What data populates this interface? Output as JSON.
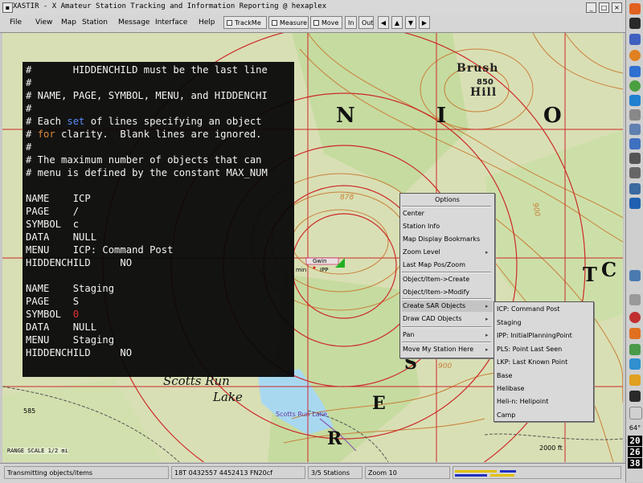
{
  "window": {
    "title": "XASTIR - X Amateur Station Tracking and Information Reporting @ hexaplex"
  },
  "menubar": {
    "items": [
      "File",
      "View",
      "Map",
      "Station",
      "Message",
      "Interface",
      "Help"
    ],
    "toggles": [
      "TrackMe",
      "Measure",
      "Move"
    ],
    "zoom_in": "In",
    "zoom_out": "Out"
  },
  "terminal": {
    "lines": [
      "#       HIDDENCHILD must be the last line",
      "#",
      "# NAME, PAGE, SYMBOL, MENU, and HIDDENCHI",
      "#",
      "# Each set of lines specifying an object",
      "# for clarity.  Blank lines are ignored.",
      "#",
      "# The maximum number of objects that can",
      "# menu is defined by the constant MAX_NUM",
      "",
      "NAME    ICP",
      "PAGE    /",
      "SYMBOL  c",
      "DATA    NULL",
      "MENU    ICP: Command Post",
      "HIDDENCHILD     NO",
      "",
      "NAME    Staging",
      "PAGE    S",
      "SYMBOL  0",
      "DATA    NULL",
      "MENU    Staging",
      "HIDDENCHILD     NO"
    ],
    "highlights": {
      "set": "set",
      "for": "for",
      "symbol_zero": "0"
    }
  },
  "map_labels": {
    "brush_hill_1": "Brush",
    "brush_hill_2": "Hill",
    "elev_850": "850",
    "elev_878": "878",
    "elev_900": "900",
    "elev_900b": "900",
    "letter_n": "N",
    "letter_i": "I",
    "letter_o": "O",
    "letter_c": "C",
    "letter_t": "T",
    "letter_s": "S",
    "letter_e": "E",
    "letter_r": "R",
    "scotts_run_1": "Scotts Run",
    "scotts_run_2": "Lake",
    "scotts_run_lake": "Scotts Run Lake",
    "station_a": "Gwin",
    "station_b": "IPP",
    "station_c": "min",
    "elev_585": "585",
    "scale": "RANGE SCALE 1/2 mi",
    "ft_2000": "2000 ft"
  },
  "options_menu": {
    "title": "Options",
    "items": [
      {
        "label": "Center",
        "submenu": false
      },
      {
        "label": "Station Info",
        "submenu": false
      },
      {
        "label": "Map Display Bookmarks",
        "submenu": false
      },
      {
        "label": "Zoom Level",
        "submenu": true
      },
      {
        "label": "Last Map Pos/Zoom",
        "submenu": false
      },
      {
        "label": "Object/Item->Create",
        "submenu": false
      },
      {
        "label": "Object/Item->Modify",
        "submenu": false
      },
      {
        "label": "Create SAR Objects",
        "submenu": true
      },
      {
        "label": "Draw CAD Objects",
        "submenu": true
      },
      {
        "label": "Pan",
        "submenu": true
      },
      {
        "label": "Move My Station Here",
        "submenu": true
      }
    ]
  },
  "sar_menu": {
    "items": [
      "ICP: Command Post",
      "Staging",
      "IPP: InitialPlanningPoint",
      "PLS: Point Last Seen",
      "LKP: Last Known Point",
      "Base",
      "Helibase",
      "Heli-n: Helipoint",
      "Camp"
    ]
  },
  "statusbar": {
    "message": "Transmitting objects/items",
    "coords": "18T 0432557 4452413  FN20cf",
    "stations": "3/5 Stations",
    "zoom": "Zoom 10"
  },
  "right_panel": {
    "temp": "64°",
    "time_h": "20",
    "time_m": "26",
    "time_s": "38"
  },
  "colors": {
    "contour": "#c8803a",
    "grid": "#cc2a2a",
    "water": "#a8d8f0",
    "forest": "#c6dba0"
  }
}
